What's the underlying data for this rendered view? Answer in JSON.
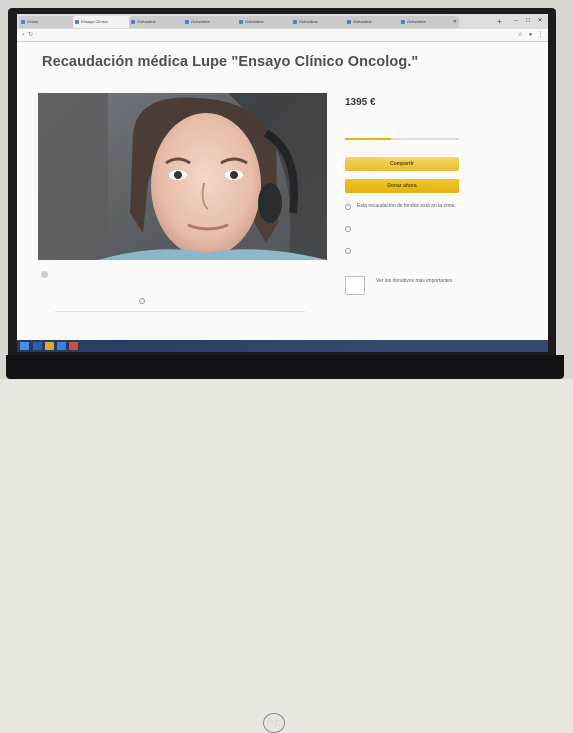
{
  "browser": {
    "tabs": [
      {
        "label": "Vimeo"
      },
      {
        "label": "Ensayo Clínico"
      },
      {
        "label": "Gofundme"
      },
      {
        "label": "Gofundme"
      },
      {
        "label": "Gofundme"
      },
      {
        "label": "Gofundme"
      },
      {
        "label": "Gofundme"
      },
      {
        "label": "Gofundme"
      }
    ],
    "new_tab": "+",
    "url": "",
    "window_controls": [
      "–",
      "□",
      "✕"
    ]
  },
  "campaign": {
    "title": "Recaudación médica Lupe \"Ensayo Clínico Oncolog.\"",
    "amount": "1395 €",
    "amount_sub": "",
    "donors": "",
    "progress_fraction": 0.4,
    "share_label": "Compartir",
    "donate_label": "Donar ahora",
    "info": [
      {
        "text": "Esta recaudación de fondos está en la zona"
      },
      {
        "text": ""
      },
      {
        "text": ""
      }
    ],
    "badge": "",
    "see_all": "Ver los donativos más importantes",
    "organizer": "",
    "created": "",
    "category": "",
    "words_title": "",
    "words_text": ""
  },
  "monitor": {
    "brand": "hp"
  },
  "taskbar": {
    "time": ""
  },
  "colors": {
    "accent": "#e8b92a",
    "taskbar": "#243b63"
  }
}
